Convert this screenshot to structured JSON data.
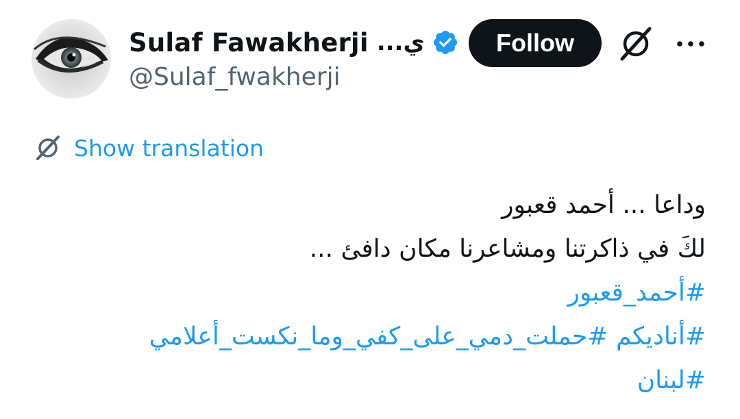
{
  "author": {
    "display_name": "Sulaf Fawakherji",
    "display_name_suffix": "...ي",
    "handle": "@Sulaf_fwakherji",
    "avatar": "avatar-eye-photo",
    "verified_icon": "verified-badge-icon"
  },
  "actions": {
    "follow_label": "Follow",
    "grok_icon": "grok-icon",
    "more_icon": "more-dots-icon"
  },
  "translation": {
    "label": "Show translation",
    "icon": "translate-icon"
  },
  "tweet": {
    "lines": [
      "وداعا ... أحمد قعبور",
      "لكَ في ذاكرتنا ومشاعرنا مكان دافئ ..."
    ],
    "hashtags": [
      "#أحمد_قعبور",
      "#أناديكم",
      "#حملت_دمي_على_كفي_وما_نكست_أعلامي",
      "#لبنان"
    ]
  },
  "colors": {
    "link": "#1d9bf0",
    "text": "#0f1419",
    "secondary": "#536471",
    "button_bg": "#0f1419"
  }
}
